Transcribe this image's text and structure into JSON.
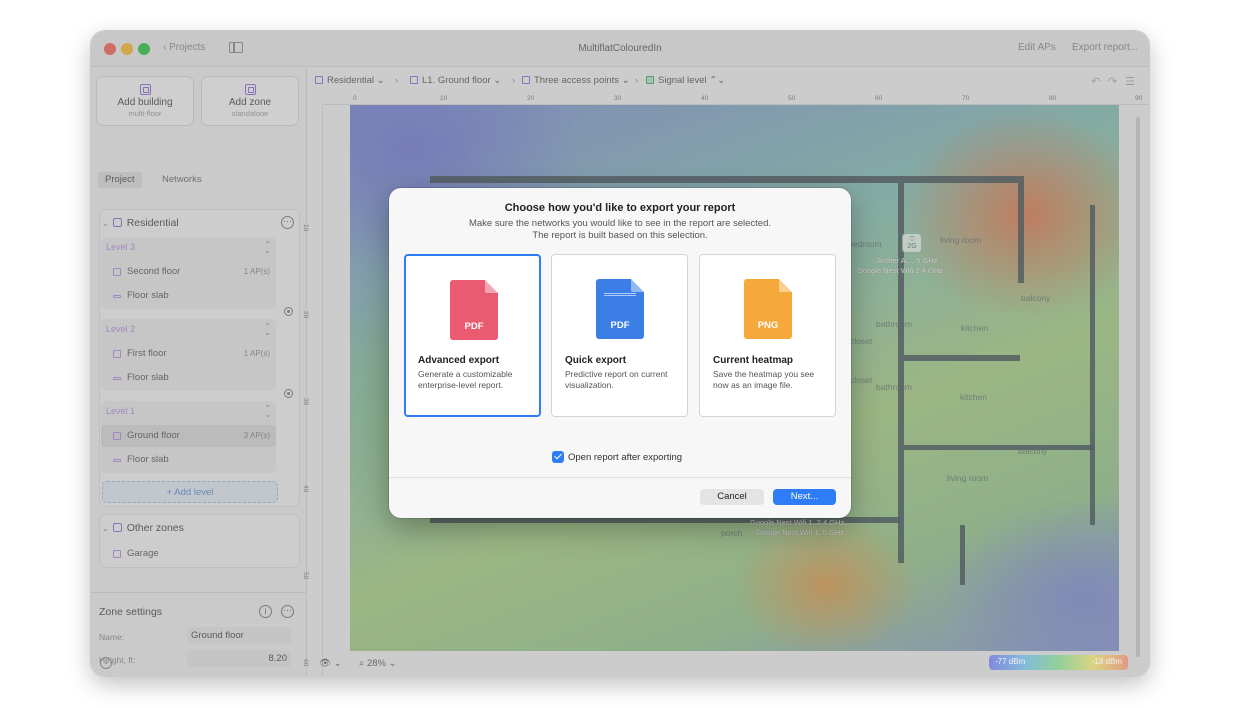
{
  "titlebar": {
    "back_label": "Projects",
    "title": "MultiflatColouredIn",
    "edit_aps": "Edit APs",
    "export_report": "Export report..."
  },
  "sidebar": {
    "add_building": {
      "label": "Add building",
      "sub": "multi-floor"
    },
    "add_zone": {
      "label": "Add zone",
      "sub": "standalone"
    },
    "tabs": [
      "Project",
      "Networks"
    ],
    "building": {
      "name": "Residential",
      "levels": [
        {
          "label": "Level 3",
          "rows": [
            {
              "name": "Second floor",
              "count": "1 AP(s)"
            },
            {
              "name": "Floor slab",
              "count": ""
            }
          ]
        },
        {
          "label": "Level 2",
          "rows": [
            {
              "name": "First floor",
              "count": "1 AP(s)"
            },
            {
              "name": "Floor slab",
              "count": ""
            }
          ]
        },
        {
          "label": "Level 1",
          "rows": [
            {
              "name": "Ground floor",
              "count": "3 AP(s)"
            },
            {
              "name": "Floor slab",
              "count": ""
            }
          ]
        }
      ],
      "add_level": "+ Add level"
    },
    "other_zones": {
      "title": "Other zones",
      "items": [
        "Garage"
      ]
    },
    "zone_settings": {
      "title": "Zone settings",
      "name_label": "Name:",
      "name_value": "Ground floor",
      "height_label": "Height, ft:",
      "height_value": "8.20"
    }
  },
  "breadcrumbs": {
    "building": "Residential",
    "floor": "L1. Ground floor",
    "aps": "Three access points",
    "layer": "Signal level"
  },
  "rulers": {
    "top": [
      "0",
      "10",
      "20",
      "30",
      "40",
      "50",
      "60",
      "70",
      "80",
      "90",
      "100"
    ],
    "left": [
      "10",
      "20",
      "30",
      "40",
      "50",
      "60"
    ]
  },
  "canvas": {
    "rooms": [
      "bedroom",
      "living room",
      "balcony",
      "bathroom",
      "kitchen",
      "closet",
      "bathroom",
      "closet",
      "kitchen",
      "balcony",
      "living room",
      "porch"
    ],
    "ap_labels": [
      "Archer A..., 5 GHz",
      "Google Nest Wifi 2.4 GHz",
      "Google Nest Wifi 1, 2.4 GHz",
      "Google Nest Wifi 1, 5 GHz"
    ],
    "ap_badge": "2G"
  },
  "statusbar": {
    "zoom": "28%",
    "legend_min": "-77 dBm",
    "legend_max": "-18 dBm"
  },
  "modal": {
    "title": "Choose how you'd like to export your report",
    "subtitle1": "Make sure the networks you would like to see in the report are selected.",
    "subtitle2": "The report is built based on this selection.",
    "options": [
      {
        "badge": "PDF",
        "title": "Advanced export",
        "desc": "Generate a customizable enterprise-level report.",
        "color": "#ea5b72"
      },
      {
        "badge": "PDF",
        "title": "Quick export",
        "desc": "Predictive report on current visualization.",
        "color": "#3b7ee6"
      },
      {
        "badge": "PNG",
        "title": "Current heatmap",
        "desc": "Save the heatmap you see now as an image file.",
        "color": "#f4a93a"
      }
    ],
    "checkbox_label": "Open report after exporting",
    "cancel": "Cancel",
    "next": "Next..."
  }
}
